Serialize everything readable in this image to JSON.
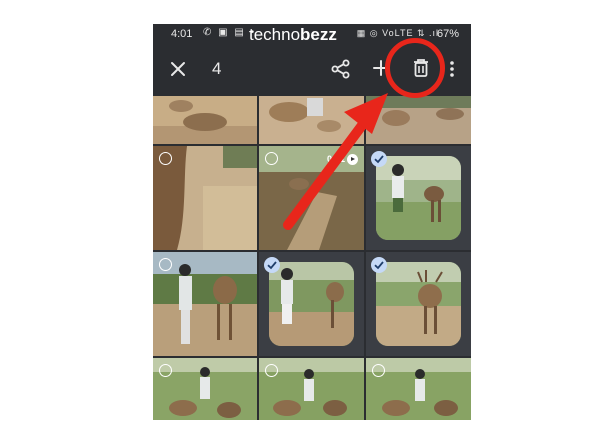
{
  "status_bar": {
    "time": "4:01",
    "left_icons": "✆ ▣ ▤ •",
    "brand_prefix": "techno",
    "brand_suffix": "bezz",
    "right_icons": "▦ ◎ VoLTE ⇅ .ıl",
    "battery": "67%"
  },
  "app_bar": {
    "selected_count": "4",
    "actions": [
      "close-icon",
      "share-icon",
      "add-icon",
      "trash-icon",
      "more-icon"
    ]
  },
  "video_badge": "0:31",
  "grid": [
    {
      "row": 1,
      "col": 1,
      "selected": false
    },
    {
      "row": 1,
      "col": 2,
      "selected": false
    },
    {
      "row": 1,
      "col": 3,
      "selected": true
    },
    {
      "row": 2,
      "col": 1,
      "selected": false
    },
    {
      "row": 2,
      "col": 2,
      "selected": true
    },
    {
      "row": 2,
      "col": 3,
      "selected": true
    },
    {
      "row": 3,
      "col": 1,
      "selected": false
    },
    {
      "row": 3,
      "col": 2,
      "selected": false
    },
    {
      "row": 3,
      "col": 3,
      "selected": false
    }
  ],
  "colors": {
    "annotation_red": "#e8261b",
    "selection_blue": "#c5d9f7",
    "app_bar_bg": "#2b2d31"
  }
}
